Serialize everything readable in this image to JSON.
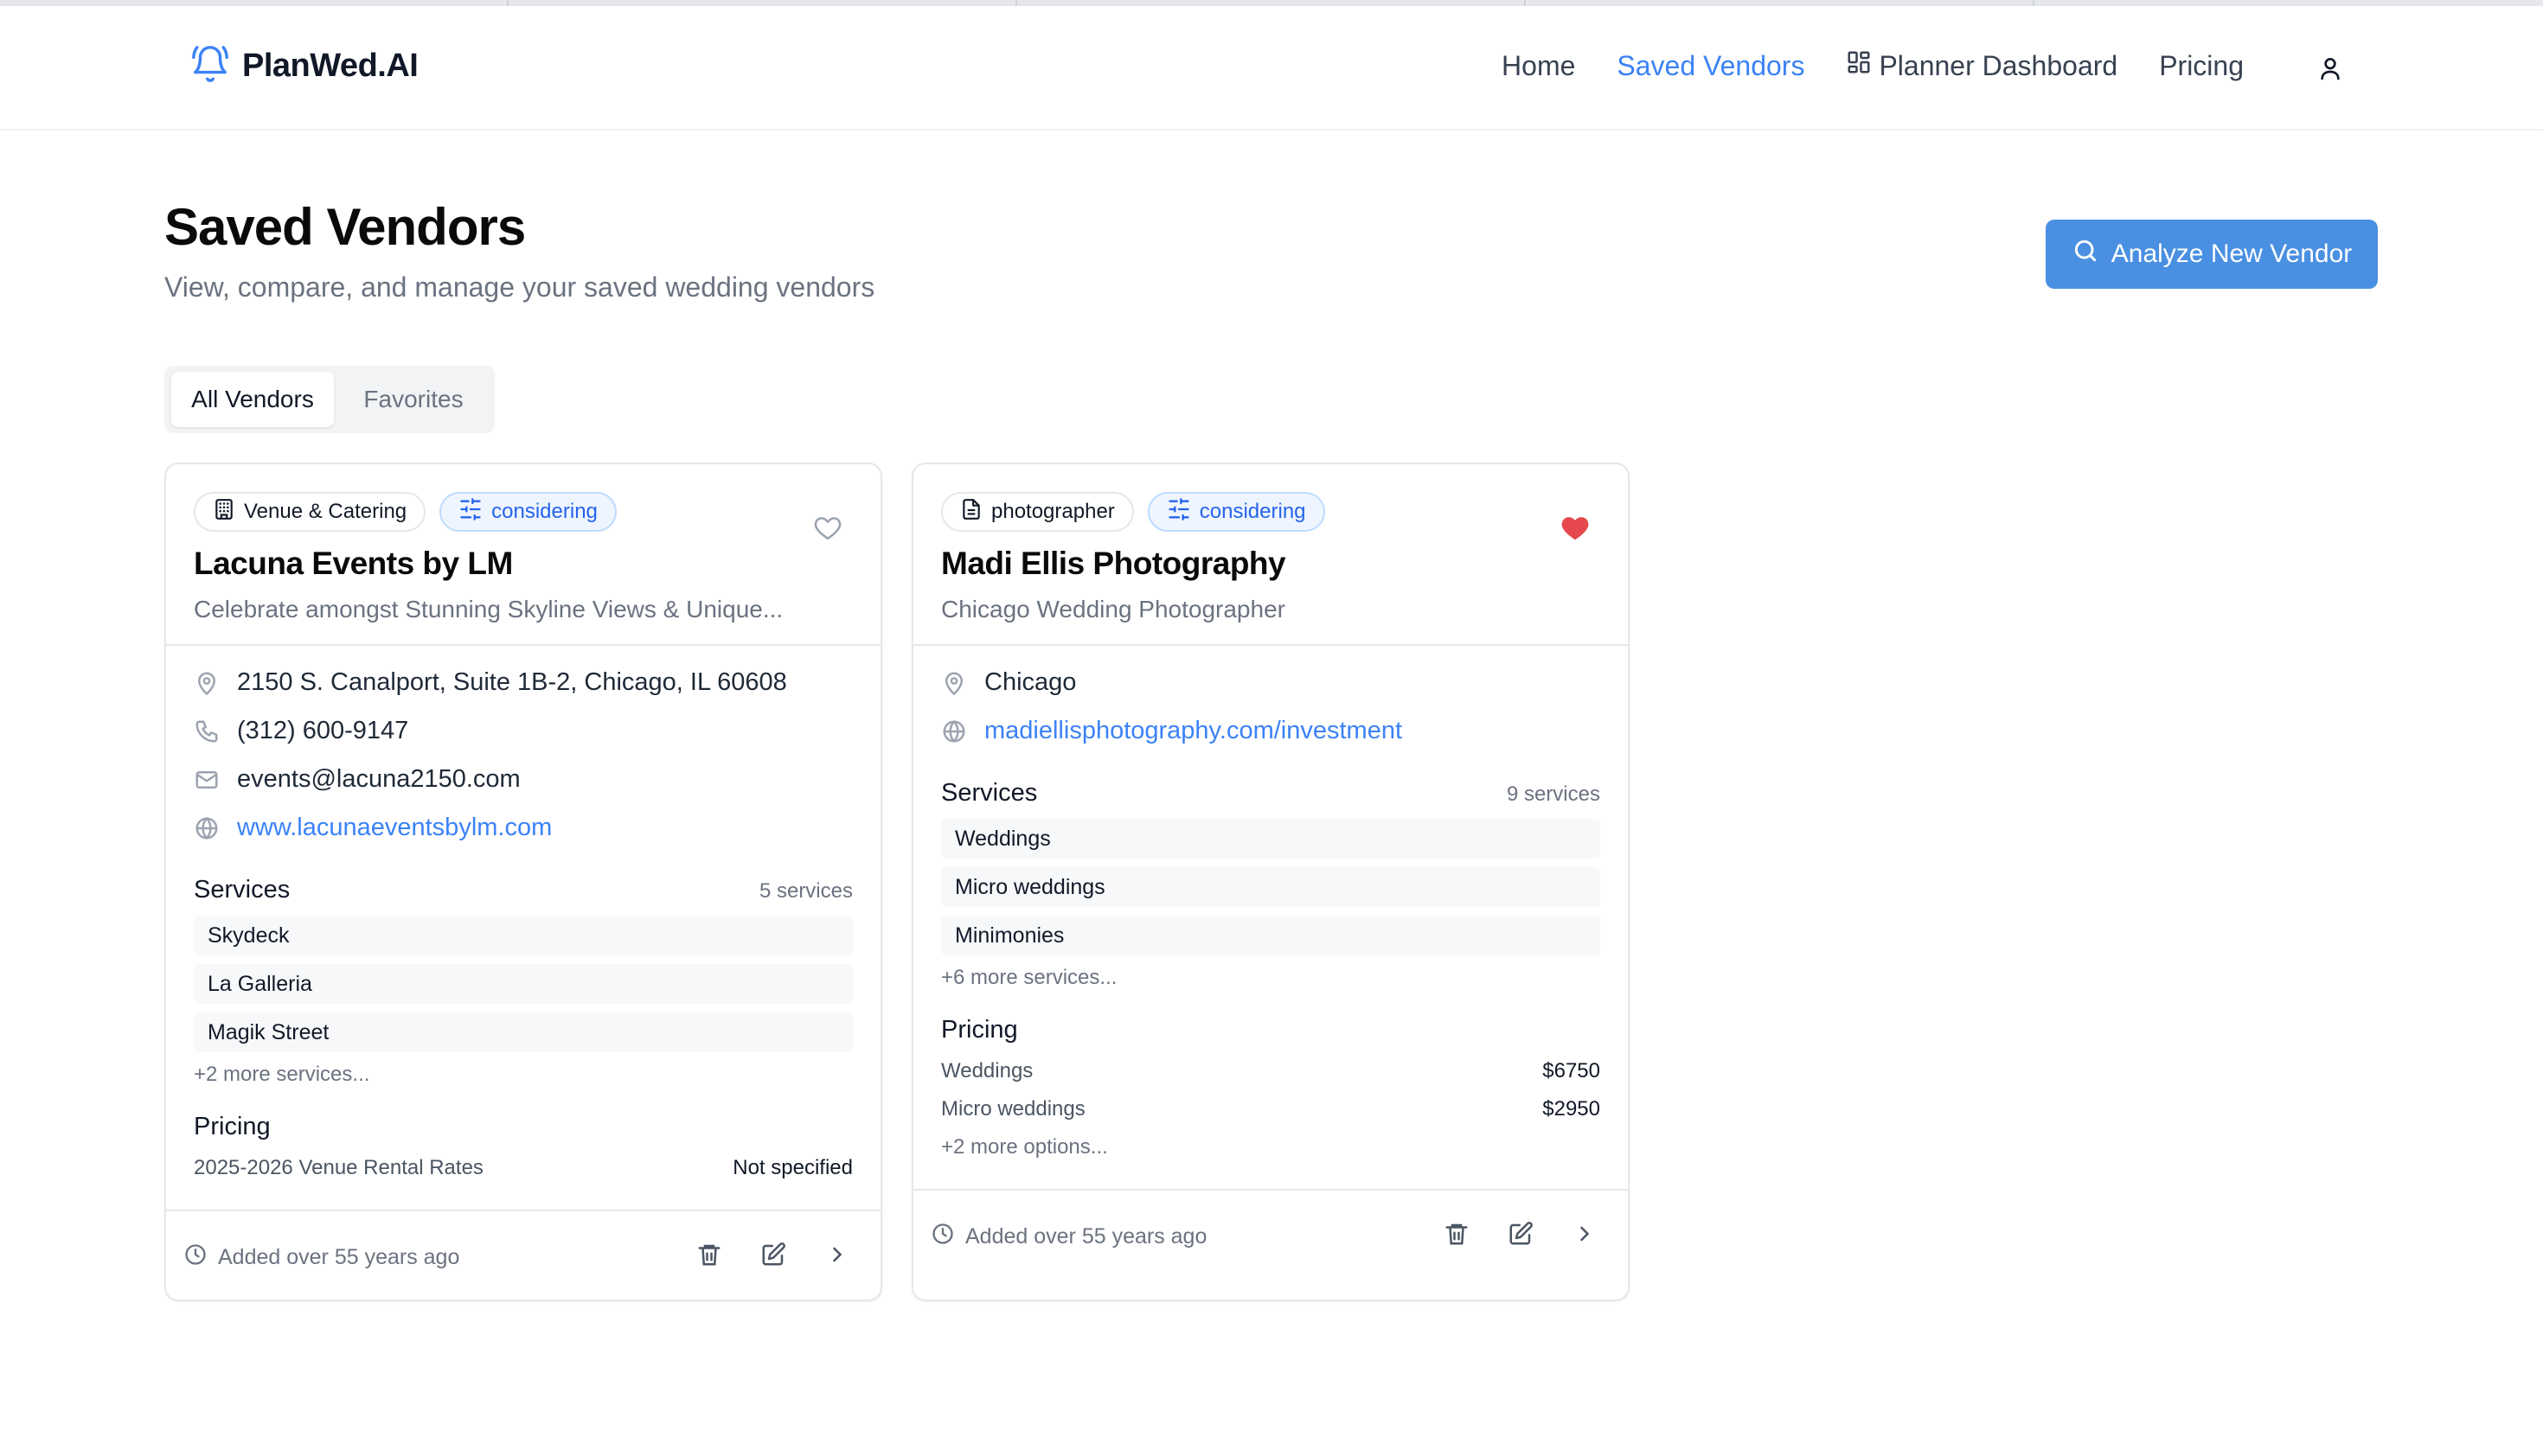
{
  "app": {
    "name": "PlanWed.AI",
    "logo_icon": "bell-icon",
    "accent_color": "#3b82f6",
    "button_color": "#4a90e2",
    "favorite_color": "#e5484d"
  },
  "nav": {
    "home": "Home",
    "saved_vendors": "Saved Vendors",
    "planner_dashboard": "Planner Dashboard",
    "pricing": "Pricing",
    "active": "saved_vendors",
    "user_icon": "user-icon"
  },
  "page": {
    "title": "Saved Vendors",
    "subtitle": "View, compare, and manage your saved wedding vendors",
    "analyze_button": "Analyze New Vendor"
  },
  "tabs": {
    "all": "All Vendors",
    "favorites": "Favorites",
    "selected": "all"
  },
  "vendors": [
    {
      "category": "Venue & Catering",
      "category_icon": "building-icon",
      "status": "considering",
      "status_icon": "sliders-icon",
      "favorite": false,
      "name": "Lacuna Events by LM",
      "tagline": "Celebrate amongst Stunning Skyline Views & Unique...",
      "address": "2150 S. Canalport, Suite 1B-2, Chicago, IL 60608",
      "phone": "(312) 600-9147",
      "email": "events@lacuna2150.com",
      "website": "www.lacunaeventsbylm.com",
      "services_title": "Services",
      "services_count": "5 services",
      "services": [
        "Skydeck",
        "La Galleria",
        "Magik Street"
      ],
      "services_more": "+2 more services...",
      "pricing_title": "Pricing",
      "pricing": [
        {
          "label": "2025-2026 Venue Rental Rates",
          "value": "Not specified"
        }
      ],
      "added": "Added over 55 years ago"
    },
    {
      "category": "photographer",
      "category_icon": "document-icon",
      "status": "considering",
      "status_icon": "sliders-icon",
      "favorite": true,
      "name": "Madi Ellis Photography",
      "tagline": "Chicago Wedding Photographer",
      "address": "Chicago",
      "website": "madiellisphotography.com/investment",
      "services_title": "Services",
      "services_count": "9 services",
      "services": [
        "Weddings",
        "Micro weddings",
        "Minimonies"
      ],
      "services_more": "+6 more services...",
      "pricing_title": "Pricing",
      "pricing": [
        {
          "label": "Weddings",
          "value": "$6750"
        },
        {
          "label": "Micro weddings",
          "value": "$2950"
        }
      ],
      "pricing_more": "+2 more options...",
      "added": "Added over 55 years ago"
    }
  ]
}
